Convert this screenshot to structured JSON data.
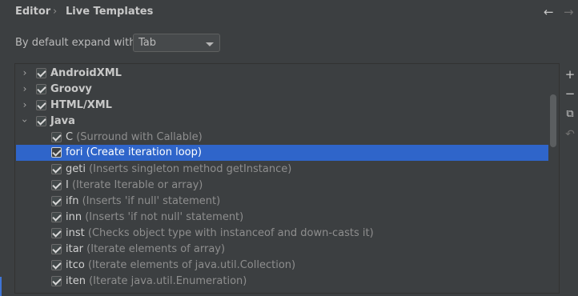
{
  "breadcrumb": {
    "parent": "Editor",
    "separator": "›",
    "current": "Live Templates"
  },
  "nav": {
    "back_icon": "←",
    "forward_icon": "→"
  },
  "expand": {
    "label": "By default expand with",
    "value": "Tab"
  },
  "groups": [
    {
      "label": "AndroidXML",
      "expanded": false,
      "checked": true
    },
    {
      "label": "Groovy",
      "expanded": false,
      "checked": true
    },
    {
      "label": "HTML/XML",
      "expanded": false,
      "checked": true
    },
    {
      "label": "Java",
      "expanded": true,
      "checked": true
    }
  ],
  "templates": [
    {
      "abbr": "C",
      "desc": "(Surround with Callable)",
      "checked": true,
      "selected": false
    },
    {
      "abbr": "fori",
      "desc": "(Create iteration loop)",
      "checked": true,
      "selected": true
    },
    {
      "abbr": "geti",
      "desc": "(Inserts singleton method getInstance)",
      "checked": true,
      "selected": false
    },
    {
      "abbr": "I",
      "desc": "(Iterate Iterable or array)",
      "checked": true,
      "selected": false
    },
    {
      "abbr": "ifn",
      "desc": "(Inserts 'if null' statement)",
      "checked": true,
      "selected": false
    },
    {
      "abbr": "inn",
      "desc": "(Inserts 'if not null' statement)",
      "checked": true,
      "selected": false
    },
    {
      "abbr": "inst",
      "desc": "(Checks object type with instanceof and down-casts it)",
      "checked": true,
      "selected": false
    },
    {
      "abbr": "itar",
      "desc": "(Iterate elements of array)",
      "checked": true,
      "selected": false
    },
    {
      "abbr": "itco",
      "desc": "(Iterate elements of java.util.Collection)",
      "checked": true,
      "selected": false
    },
    {
      "abbr": "iten",
      "desc": "(Iterate java.util.Enumeration)",
      "checked": true,
      "selected": false
    }
  ],
  "toolbar": {
    "add_icon": "+",
    "remove_icon": "−",
    "copy_icon": "⧉",
    "restore_icon": "↶"
  },
  "colors": {
    "selection": "#2f65ca",
    "background": "#3c3f41"
  }
}
